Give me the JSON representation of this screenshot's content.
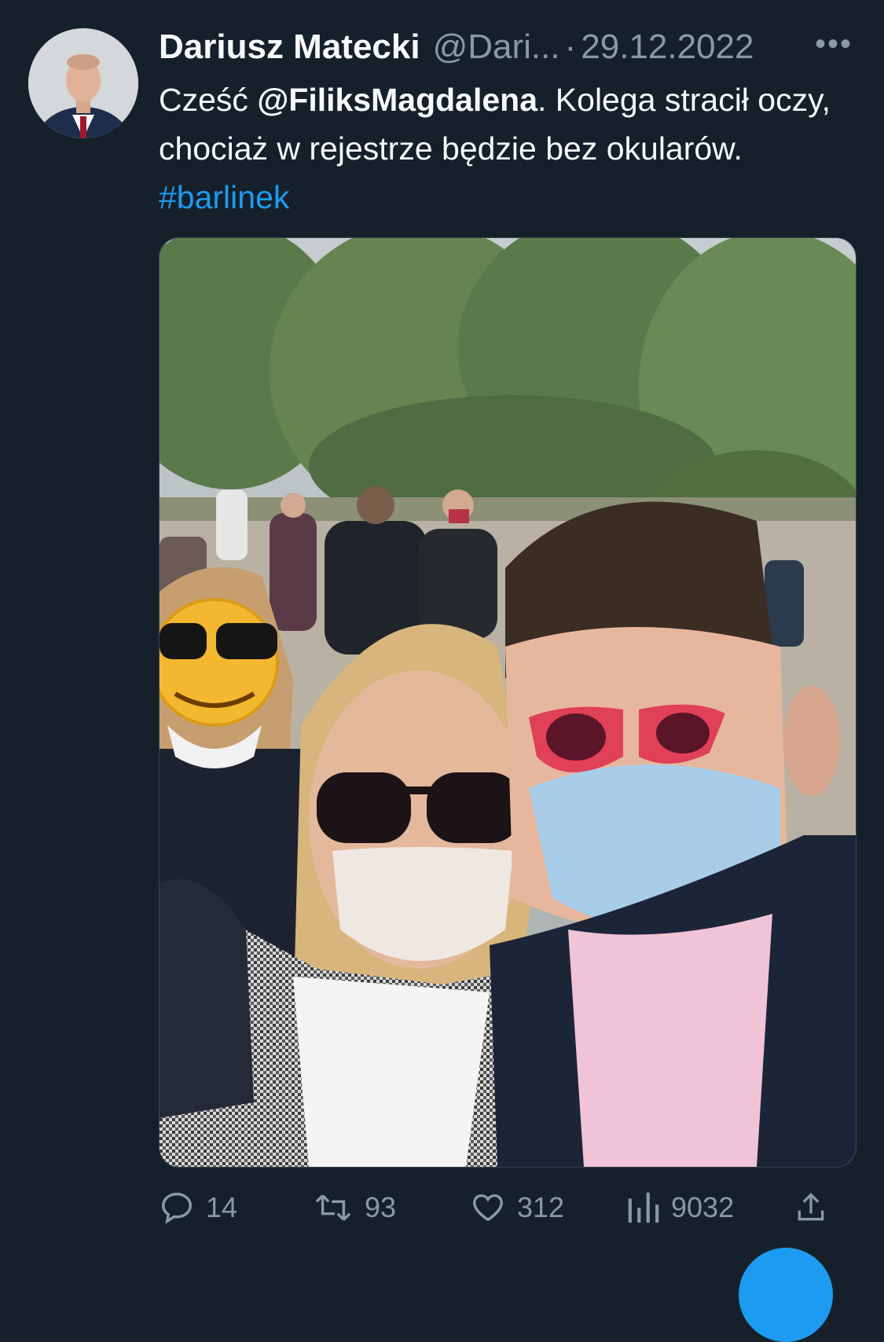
{
  "tweet": {
    "author_name": "Dariusz Matecki",
    "handle": "@Dari...",
    "separator": "·",
    "date": "29.12.2022",
    "more_icon": "more-dots-icon",
    "text_prefix": "Cześć ",
    "mention": "@FiliksMagdalena",
    "text_middle": ". Kolega stracił oczy, chociaż w rejestrze będzie bez okularów. ",
    "hashtag": "#barlinek"
  },
  "actions": {
    "replies": "14",
    "retweets": "93",
    "likes": "312",
    "views": "9032"
  },
  "colors": {
    "background": "#15202b",
    "link": "#1d9bf0",
    "secondary": "#8b98a5",
    "mask_pink": "#e04058"
  }
}
